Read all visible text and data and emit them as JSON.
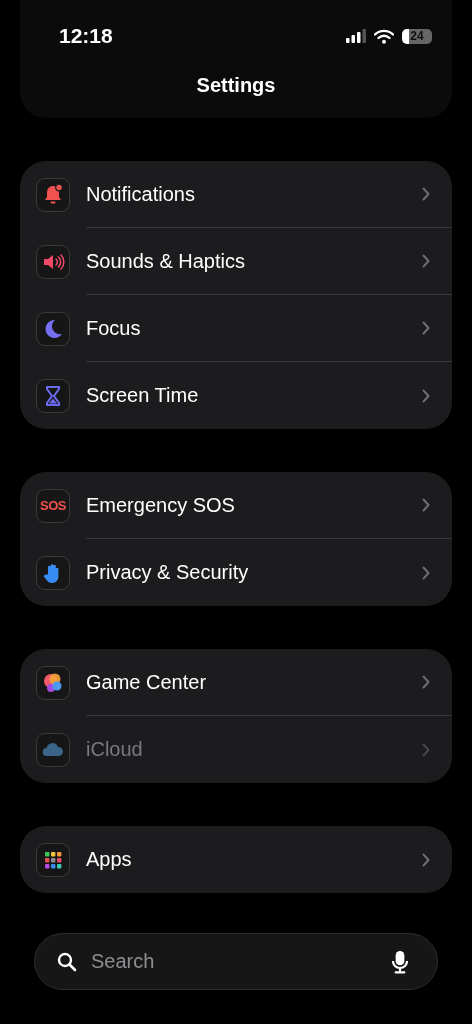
{
  "status_bar": {
    "time": "12:18",
    "battery": "24"
  },
  "title": "Settings",
  "groups": [
    {
      "items": [
        {
          "label": "Notifications",
          "kind": "bell",
          "dimmed": false
        },
        {
          "label": "Sounds & Haptics",
          "kind": "speaker",
          "dimmed": false
        },
        {
          "label": "Focus",
          "kind": "moon",
          "dimmed": false
        },
        {
          "label": "Screen Time",
          "kind": "hourglass",
          "dimmed": false
        }
      ]
    },
    {
      "items": [
        {
          "label": "Emergency SOS",
          "kind": "sos",
          "icon_text": "SOS",
          "dimmed": false
        },
        {
          "label": "Privacy & Security",
          "kind": "hand",
          "dimmed": false
        }
      ]
    },
    {
      "items": [
        {
          "label": "Game Center",
          "kind": "bubbles",
          "dimmed": false
        },
        {
          "label": "iCloud",
          "kind": "cloud",
          "dimmed": true
        }
      ]
    },
    {
      "items": [
        {
          "label": "Apps",
          "kind": "grid",
          "dimmed": false
        }
      ]
    }
  ],
  "search": {
    "placeholder": "Search"
  }
}
